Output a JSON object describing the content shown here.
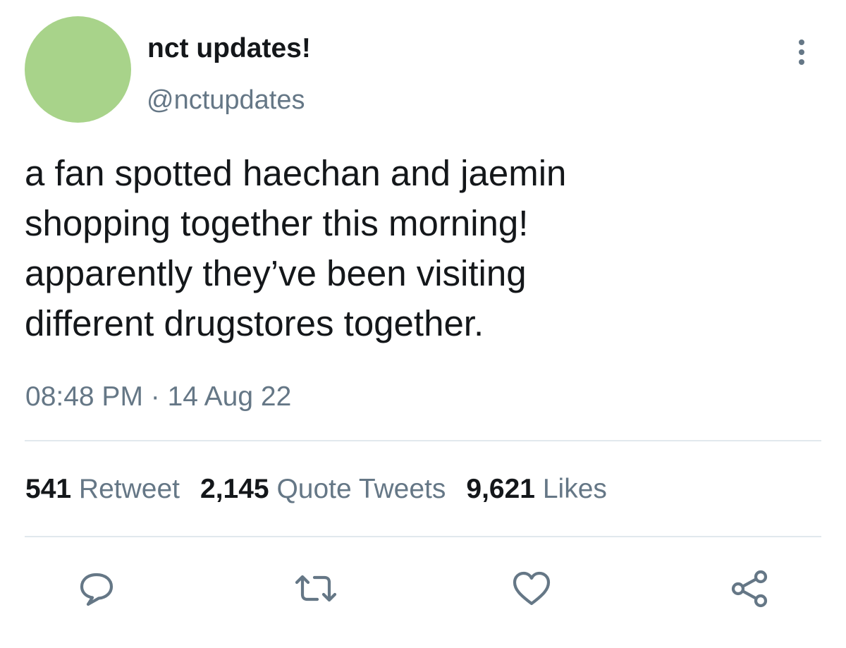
{
  "author": {
    "display_name": "nct updates!",
    "handle": "@nctupdates",
    "avatar_color": "#a8d38a"
  },
  "more_menu_icon": "more-vertical-icon",
  "tweet": {
    "text_lines": [
      "a fan spotted haechan and jaemin",
      "shopping together this morning!",
      "apparently they’ve been visiting",
      "different drugstores together."
    ],
    "timestamp": "08:48 PM · 14 Aug 22"
  },
  "stats": {
    "retweets": {
      "count": "541",
      "label": "Retweet"
    },
    "quotes": {
      "count": "2,145",
      "label": "Quote Tweets"
    },
    "likes": {
      "count": "9,621",
      "label": "Likes"
    }
  },
  "actions": [
    {
      "name": "reply",
      "icon": "reply-icon"
    },
    {
      "name": "retweet",
      "icon": "retweet-icon"
    },
    {
      "name": "like",
      "icon": "heart-icon"
    },
    {
      "name": "share",
      "icon": "share-icon"
    }
  ],
  "colors": {
    "primary_text": "#14171a",
    "secondary_text": "#657786",
    "divider": "#e1e8ed"
  }
}
